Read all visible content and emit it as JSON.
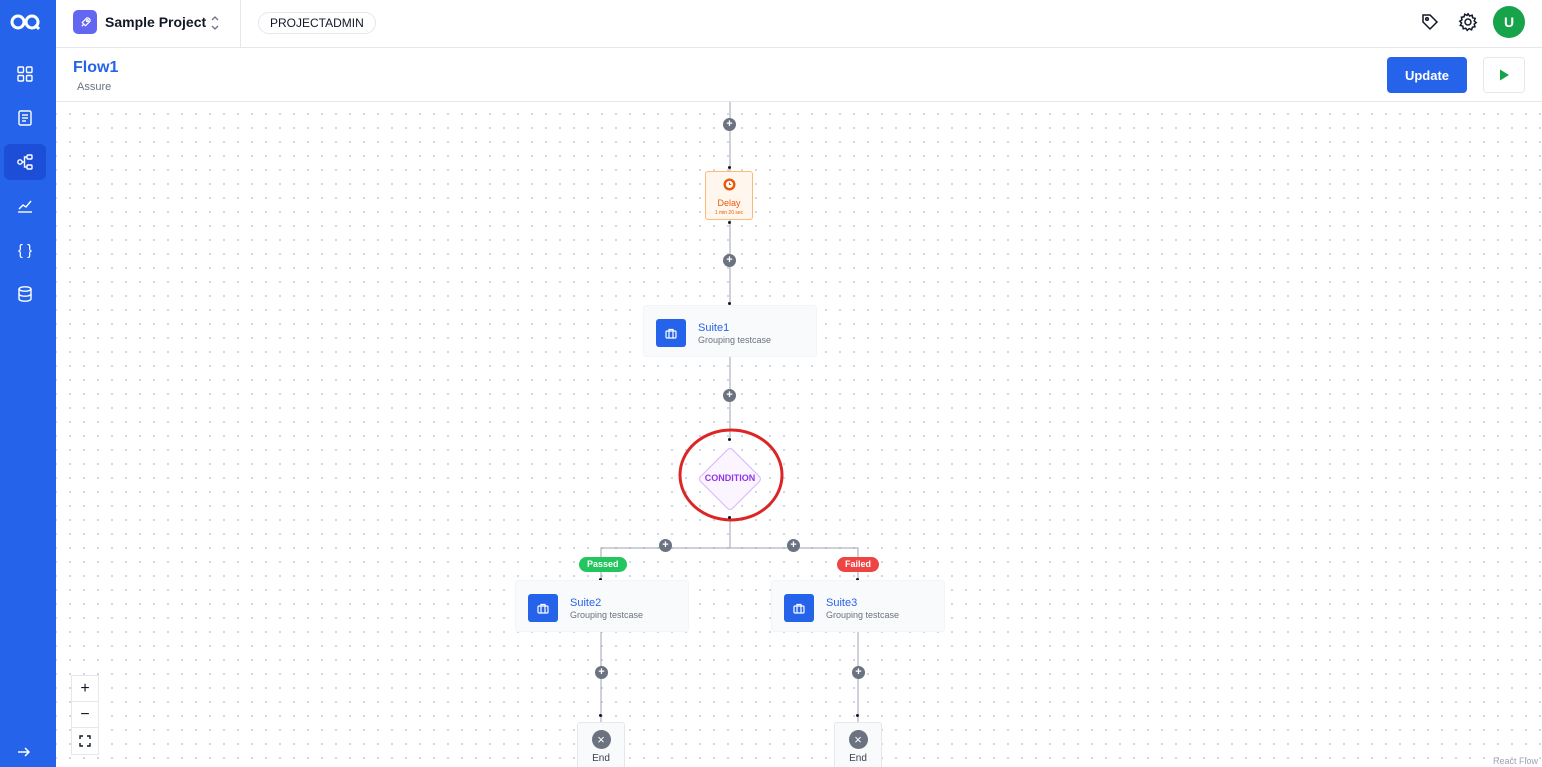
{
  "project": {
    "name": "Sample Project",
    "role": "PROJECTADMIN"
  },
  "user": {
    "initial": "U"
  },
  "flow": {
    "title": "Flow1",
    "subtitle": "Assure",
    "update_label": "Update"
  },
  "sidebar": {
    "items": [
      {
        "icon": "grid-icon"
      },
      {
        "icon": "list-icon"
      },
      {
        "icon": "flow-icon",
        "active": true
      },
      {
        "icon": "chart-icon"
      },
      {
        "icon": "braces-icon",
        "label": "{ }"
      },
      {
        "icon": "database-icon"
      }
    ]
  },
  "nodes": {
    "delay": {
      "label": "Delay",
      "time": "1 min 20 sec"
    },
    "suite1": {
      "name": "Suite1",
      "desc": "Grouping testcase"
    },
    "condition": {
      "label": "CONDITION"
    },
    "passed": {
      "label": "Passed"
    },
    "failed": {
      "label": "Failed"
    },
    "suite2": {
      "name": "Suite2",
      "desc": "Grouping testcase"
    },
    "suite3": {
      "name": "Suite3",
      "desc": "Grouping testcase"
    },
    "end_left": {
      "label": "End"
    },
    "end_right": {
      "label": "End"
    }
  },
  "zoom": {
    "in": "+",
    "out": "−"
  },
  "attribution": "React Flow",
  "colors": {
    "accent": "#2563eb",
    "passed": "#22c55e",
    "failed": "#ef4444",
    "condition": "#9333ea",
    "delay": "#ea580c"
  }
}
